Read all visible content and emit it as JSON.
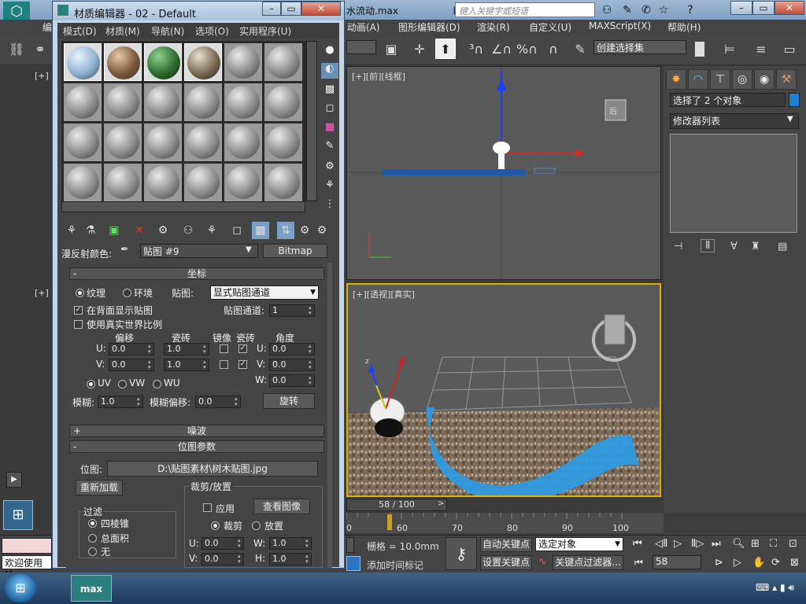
{
  "main": {
    "file_title": "水流动.max",
    "search_placeholder": "键入关键字或短语",
    "menu": [
      "编",
      "动画(A)",
      "图形编辑器(D)",
      "渲染(R)",
      "自定义(U)",
      "MAXScript(X)",
      "帮助(H)"
    ],
    "selection_set": "创建选择集",
    "viewport_front_label": "[+][前][线框]",
    "viewport_persp_label": "[+][透视][真实]",
    "viewport_left_label": "[+]",
    "viewport_left_label2": "[+]",
    "selected_text": "选择了 2 个对象",
    "modifier_list": "修改器列表",
    "time_slider": "58 / 100",
    "timeline_ticks": [
      "0",
      "60",
      "70",
      "80",
      "90",
      "100"
    ],
    "grid_text": "栅格 = 10.0mm",
    "add_time_tag": "添加时间标记",
    "auto_key": "自动关键点",
    "set_key": "设置关键点",
    "selected_object": "选定对象",
    "key_filters": "关键点过滤器...",
    "current_frame": "58",
    "welcome": "欢迎使用 M",
    "selection_color": "#1d7fd1"
  },
  "material_editor": {
    "title": "材质编辑器 - 02 - Default",
    "menu": [
      "模式(D)",
      "材质(M)",
      "导航(N)",
      "选项(O)",
      "实用程序(U)"
    ],
    "diffuse_label": "漫反射颜色:",
    "map_name": "贴图 #9",
    "map_type": "Bitmap",
    "coordinates": {
      "header": "坐标",
      "texture": "纹理",
      "environ": "环境",
      "mapping_label": "贴图:",
      "mapping_value": "显式贴图通道",
      "show_back": "在背面显示贴图",
      "map_channel_label": "贴图通道:",
      "map_channel": "1",
      "real_world": "使用真实世界比例",
      "offset": "偏移",
      "tiling": "瓷砖",
      "mirror": "镜像",
      "tile": "瓷砖",
      "angle": "角度",
      "u_label": "U:",
      "v_label": "V:",
      "w_label": "W:",
      "u_offset": "0.0",
      "v_offset": "0.0",
      "u_tiling": "1.0",
      "v_tiling": "1.0",
      "u_angle": "0.0",
      "v_angle": "0.0",
      "w_angle": "0.0",
      "uv": "UV",
      "vw": "VW",
      "wu": "WU",
      "blur_label": "模糊:",
      "blur": "1.0",
      "blur_offset_label": "模糊偏移:",
      "blur_offset": "0.0",
      "rotate": "旋转"
    },
    "noise_header": "噪波",
    "bitmap_params": {
      "header": "位图参数",
      "bitmap_label": "位图:",
      "bitmap_path": "D:\\贴图素材\\树木贴图.jpg",
      "reload": "重新加载",
      "filter_title": "过滤",
      "filter_pyramidal": "四棱锥",
      "filter_sat": "总面积",
      "filter_none": "无",
      "crop_title": "裁剪/放置",
      "apply": "应用",
      "view_image": "查看图像",
      "crop": "裁剪",
      "place": "放置",
      "u_label": "U:",
      "v_label": "V:",
      "w_label": "W:",
      "h_label": "H:",
      "u": "0.0",
      "v": "0.0",
      "w": "1.0",
      "h": "1.0"
    }
  }
}
